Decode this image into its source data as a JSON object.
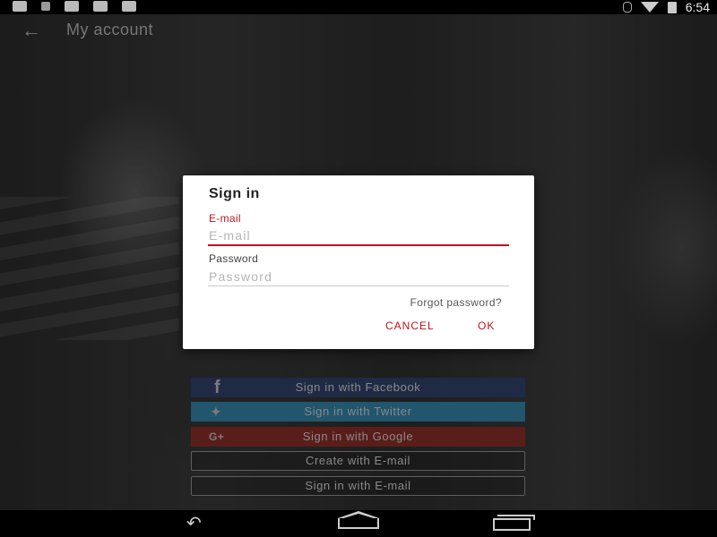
{
  "status_bar": {
    "time": "6:54"
  },
  "toolbar": {
    "title": "My account"
  },
  "dialog": {
    "title": "Sign in",
    "email_label": "E-mail",
    "email_placeholder": "E-mail",
    "password_label": "Password",
    "password_placeholder": "Password",
    "forgot_link": "Forgot password?",
    "cancel_label": "CANCEL",
    "ok_label": "OK"
  },
  "buttons": {
    "facebook": "Sign in with Facebook",
    "twitter": "Sign in with Twitter",
    "google": "Sign in with Google",
    "create_email": "Create with E-mail",
    "signin_email": "Sign in with E-mail"
  },
  "colors": {
    "accent": "#c1121f",
    "facebook": "#1f2a44",
    "twitter": "#22556e",
    "google": "#5a1e1a"
  }
}
